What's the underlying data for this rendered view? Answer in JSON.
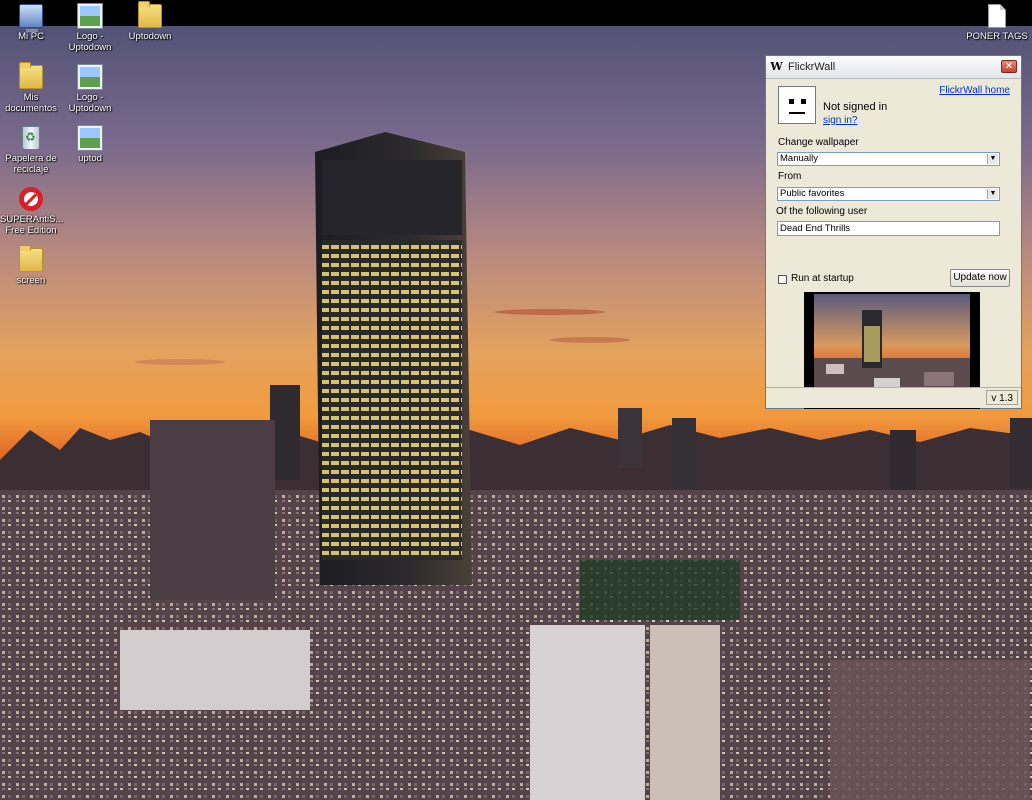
{
  "desktop": {
    "icons": [
      {
        "label": "Mi PC",
        "icon": "computer-icon"
      },
      {
        "label": "Logo - Uptodown",
        "icon": "image-file-icon"
      },
      {
        "label": "Uptodown",
        "icon": "folder-icon"
      },
      {
        "label": "Mis documentos",
        "icon": "documents-folder-icon"
      },
      {
        "label": "Logo - Uptodown",
        "icon": "image-file-icon"
      },
      {
        "label": "Papelera de reciclaje",
        "icon": "recycle-bin-icon"
      },
      {
        "label": "uptod",
        "icon": "image-file-icon"
      },
      {
        "label": "SUPERAntiS... Free Edition",
        "icon": "antispyware-icon"
      },
      {
        "label": "screen",
        "icon": "folder-icon"
      },
      {
        "label": "PONER TAGS",
        "icon": "text-file-icon"
      }
    ]
  },
  "window": {
    "title": "FlickrWall",
    "app_icon": "W",
    "close_glyph": "✕",
    "home_link": "FlickrWall home",
    "status": "Not signed in",
    "sign_in_link": "sign in?",
    "change_wallpaper_label": "Change wallpaper",
    "change_wallpaper_value": "Manually",
    "from_label": "From",
    "from_value": "Public favorites",
    "user_label": "Of the following user",
    "user_value": "Dead End Thrills",
    "run_at_startup_label": "Run at startup",
    "run_at_startup_checked": false,
    "update_button": "Update now",
    "version": "v 1.3",
    "dropdown_arrow": "▼"
  },
  "colors": {
    "link": "#0033cc",
    "window_bg": "#ece9d8",
    "close_button": "#c04530"
  }
}
